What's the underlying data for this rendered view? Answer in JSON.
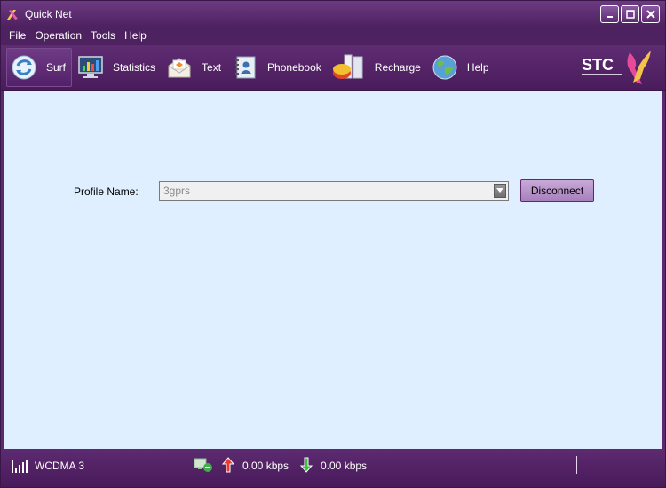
{
  "window": {
    "title": "Quick Net"
  },
  "menu": {
    "items": [
      "File",
      "Operation",
      "Tools",
      "Help"
    ]
  },
  "toolbar": {
    "items": [
      {
        "label": "Surf",
        "icon": "surf-icon"
      },
      {
        "label": "Statistics",
        "icon": "statistics-icon"
      },
      {
        "label": "Text",
        "icon": "envelope-icon"
      },
      {
        "label": "Phonebook",
        "icon": "phonebook-icon"
      },
      {
        "label": "Recharge",
        "icon": "recharge-icon"
      },
      {
        "label": "Help",
        "icon": "globe-icon"
      }
    ],
    "brand": "STC"
  },
  "main": {
    "profile_label": "Profile Name:",
    "profile_value": "3gprs",
    "disconnect_label": "Disconnect"
  },
  "status": {
    "network": "WCDMA  3",
    "upload": "0.00 kbps",
    "download": "0.00 kbps"
  },
  "colors": {
    "frame": "#5b2a6e",
    "content_bg": "#dfefff",
    "button_bg": "#b892cb"
  }
}
